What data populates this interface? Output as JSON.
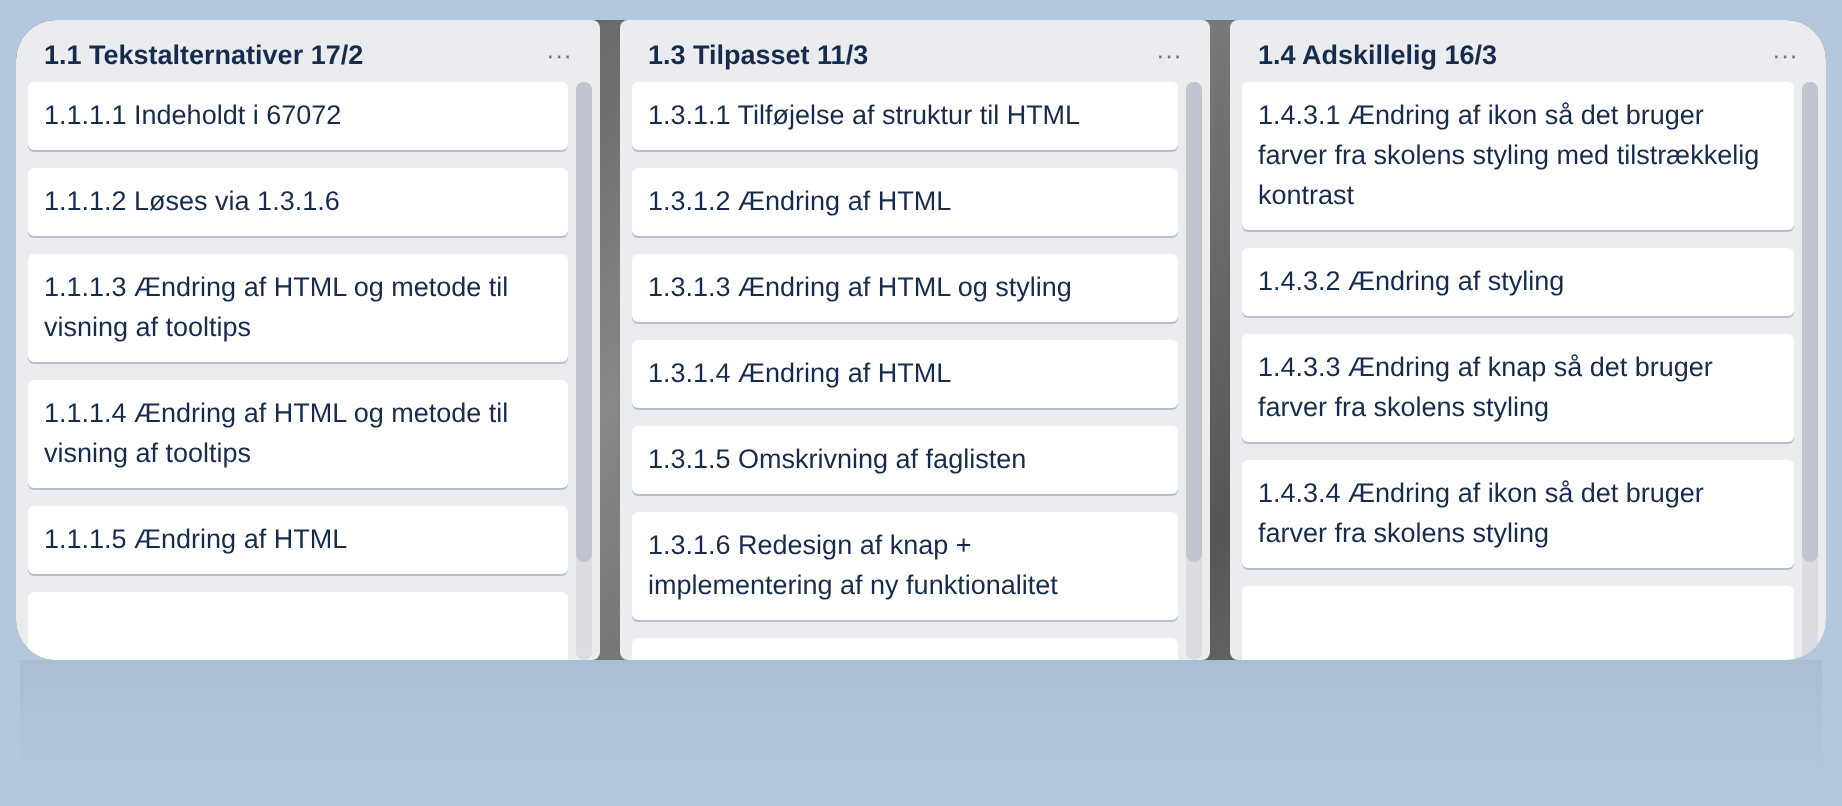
{
  "lists": [
    {
      "title": "1.1 Tekstalternativer 17/2",
      "menu": "···",
      "cards": [
        "1.1.1.1 Indeholdt i 67072",
        "1.1.1.2 Løses via 1.3.1.6",
        "1.1.1.3 Ændring af HTML og metode til visning af tooltips",
        "1.1.1.4 Ændring af HTML og metode til visning af tooltips",
        "1.1.1.5 Ændring af HTML"
      ]
    },
    {
      "title": "1.3 Tilpasset 11/3",
      "menu": "···",
      "cards": [
        "1.3.1.1 Tilføjelse af struktur til HTML",
        "1.3.1.2 Ændring af HTML",
        "1.3.1.3 Ændring af HTML og styling",
        "1.3.1.4 Ændring af HTML",
        "1.3.1.5 Omskrivning af faglisten",
        "1.3.1.6 Redesign af knap + implementering af ny funktionalitet"
      ]
    },
    {
      "title": "1.4 Adskillelig 16/3",
      "menu": "···",
      "cards": [
        "1.4.3.1 Ændring af ikon så det bruger farver fra skolens styling med tilstrækkelig kontrast",
        "1.4.3.2 Ændring af styling",
        "1.4.3.3 Ændring af knap så det bruger farver fra skolens styling",
        "1.4.3.4 Ændring af ikon så det bruger farver fra skolens styling"
      ]
    }
  ]
}
